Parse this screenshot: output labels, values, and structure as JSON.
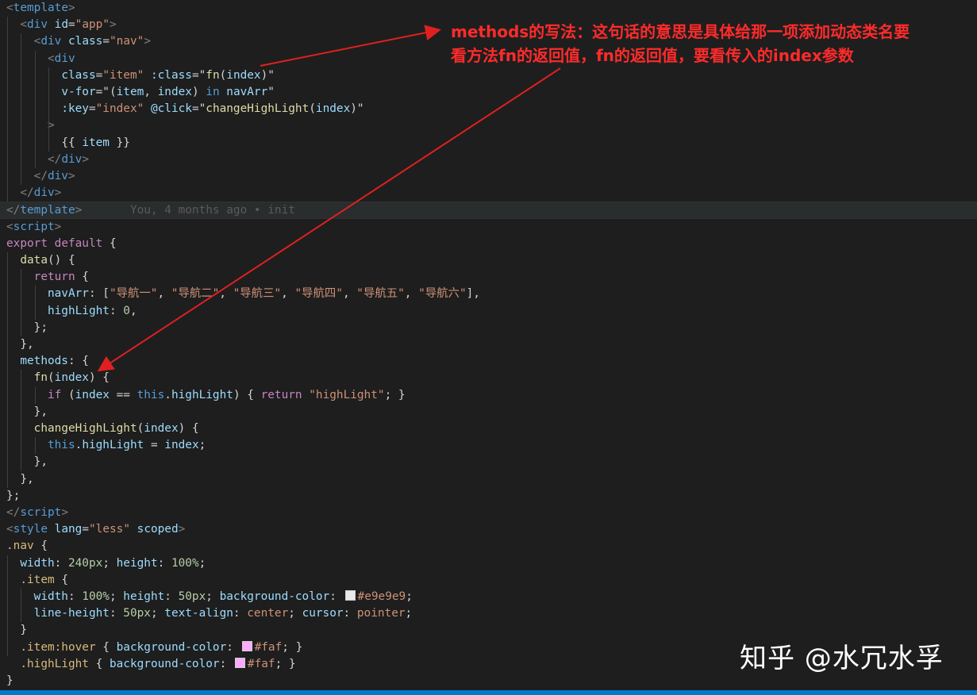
{
  "colors": {
    "background": "#1e1e1e",
    "tag": "#808080",
    "tag_name": "#569cd6",
    "attr": "#9cdcfe",
    "string": "#ce9178",
    "keyword": "#c586c0",
    "func": "#dcdcaa",
    "plain": "#d4d4d4",
    "number": "#b5cea8",
    "blame": "#5a5a5a",
    "selector": "#d7ba7d",
    "css_value": "#ce9178",
    "annotation": "#ff2b2b",
    "statusbar": "#007acc",
    "swatch_e9": "#e9e9e9",
    "swatch_faf": "#ffaaff"
  },
  "code_lines": [
    [
      [
        "<",
        "#808080"
      ],
      [
        "template",
        "#569cd6"
      ],
      [
        ">",
        "#808080"
      ]
    ],
    [
      [
        "  "
      ],
      [
        "<",
        "#808080"
      ],
      [
        "div",
        "#569cd6"
      ],
      [
        " "
      ],
      [
        "id",
        "#9cdcfe"
      ],
      [
        "=",
        "#d4d4d4"
      ],
      [
        "\"app\"",
        "#ce9178"
      ],
      [
        ">",
        "#808080"
      ]
    ],
    [
      [
        "    "
      ],
      [
        "<",
        "#808080"
      ],
      [
        "div",
        "#569cd6"
      ],
      [
        " "
      ],
      [
        "class",
        "#9cdcfe"
      ],
      [
        "=",
        "#d4d4d4"
      ],
      [
        "\"nav\"",
        "#ce9178"
      ],
      [
        ">",
        "#808080"
      ]
    ],
    [
      [
        "      "
      ],
      [
        "<",
        "#808080"
      ],
      [
        "div",
        "#569cd6"
      ]
    ],
    [
      [
        "        "
      ],
      [
        "class",
        "#9cdcfe"
      ],
      [
        "=",
        "#d4d4d4"
      ],
      [
        "\"item\"",
        "#ce9178"
      ],
      [
        " "
      ],
      [
        ":class",
        "#9cdcfe"
      ],
      [
        "=\"",
        "#d4d4d4"
      ],
      [
        "fn",
        "#dcdcaa"
      ],
      [
        "(",
        "#d4d4d4"
      ],
      [
        "index",
        "#9cdcfe"
      ],
      [
        ")\"",
        "#d4d4d4"
      ]
    ],
    [
      [
        "        "
      ],
      [
        "v-for",
        "#9cdcfe"
      ],
      [
        "=\"(",
        "#d4d4d4"
      ],
      [
        "item",
        "#9cdcfe"
      ],
      [
        ", ",
        "#d4d4d4"
      ],
      [
        "index",
        "#9cdcfe"
      ],
      [
        ") ",
        "#d4d4d4"
      ],
      [
        "in",
        "#569cd6"
      ],
      [
        " "
      ],
      [
        "navArr",
        "#9cdcfe"
      ],
      [
        "\"",
        "#d4d4d4"
      ]
    ],
    [
      [
        "        "
      ],
      [
        ":key",
        "#9cdcfe"
      ],
      [
        "=",
        "#d4d4d4"
      ],
      [
        "\"index\"",
        "#ce9178"
      ],
      [
        " "
      ],
      [
        "@click",
        "#9cdcfe"
      ],
      [
        "=\"",
        "#d4d4d4"
      ],
      [
        "changeHighLight",
        "#dcdcaa"
      ],
      [
        "(",
        "#d4d4d4"
      ],
      [
        "index",
        "#9cdcfe"
      ],
      [
        ")\"",
        "#d4d4d4"
      ]
    ],
    [
      [
        "      "
      ],
      [
        ">",
        "#808080"
      ]
    ],
    [
      [
        "        "
      ],
      [
        "{{ ",
        "#d4d4d4"
      ],
      [
        "item",
        "#9cdcfe"
      ],
      [
        " }}",
        "#d4d4d4"
      ]
    ],
    [
      [
        "      "
      ],
      [
        "</",
        "#808080"
      ],
      [
        "div",
        "#569cd6"
      ],
      [
        ">",
        "#808080"
      ]
    ],
    [
      [
        "    "
      ],
      [
        "</",
        "#808080"
      ],
      [
        "div",
        "#569cd6"
      ],
      [
        ">",
        "#808080"
      ]
    ],
    [
      [
        "  "
      ],
      [
        "</",
        "#808080"
      ],
      [
        "div",
        "#569cd6"
      ],
      [
        ">",
        "#808080"
      ]
    ],
    [
      [
        "</",
        "#808080"
      ],
      [
        "template",
        "#569cd6"
      ],
      [
        ">",
        "#808080"
      ],
      [
        "       You, 4 months ago • init",
        "#5a5a5a"
      ]
    ],
    [
      [
        "<",
        "#808080"
      ],
      [
        "script",
        "#569cd6"
      ],
      [
        ">",
        "#808080"
      ]
    ],
    [
      [
        "export",
        "#c586c0"
      ],
      [
        " "
      ],
      [
        "default",
        "#c586c0"
      ],
      [
        " {",
        "#d4d4d4"
      ]
    ],
    [
      [
        "  "
      ],
      [
        "data",
        "#dcdcaa"
      ],
      [
        "() {",
        "#d4d4d4"
      ]
    ],
    [
      [
        "    "
      ],
      [
        "return",
        "#c586c0"
      ],
      [
        " {",
        "#d4d4d4"
      ]
    ],
    [
      [
        "      "
      ],
      [
        "navArr",
        "#9cdcfe"
      ],
      [
        ": [",
        "#d4d4d4"
      ],
      [
        "\"导航一\"",
        "#ce9178"
      ],
      [
        ", ",
        "#d4d4d4"
      ],
      [
        "\"导航二\"",
        "#ce9178"
      ],
      [
        ", ",
        "#d4d4d4"
      ],
      [
        "\"导航三\"",
        "#ce9178"
      ],
      [
        ", ",
        "#d4d4d4"
      ],
      [
        "\"导航四\"",
        "#ce9178"
      ],
      [
        ", ",
        "#d4d4d4"
      ],
      [
        "\"导航五\"",
        "#ce9178"
      ],
      [
        ", ",
        "#d4d4d4"
      ],
      [
        "\"导航六\"",
        "#ce9178"
      ],
      [
        "],",
        "#d4d4d4"
      ]
    ],
    [
      [
        "      "
      ],
      [
        "highLight",
        "#9cdcfe"
      ],
      [
        ": ",
        "#d4d4d4"
      ],
      [
        "0",
        "#b5cea8"
      ],
      [
        ",",
        "#d4d4d4"
      ]
    ],
    [
      [
        "    "
      ],
      [
        "};",
        "#d4d4d4"
      ]
    ],
    [
      [
        "  "
      ],
      [
        "},",
        "#d4d4d4"
      ]
    ],
    [
      [
        "  "
      ],
      [
        "methods",
        "#9cdcfe"
      ],
      [
        ": {",
        "#d4d4d4"
      ]
    ],
    [
      [
        "    "
      ],
      [
        "fn",
        "#dcdcaa"
      ],
      [
        "(",
        "#d4d4d4"
      ],
      [
        "index",
        "#9cdcfe"
      ],
      [
        ") {",
        "#d4d4d4"
      ]
    ],
    [
      [
        "      "
      ],
      [
        "if",
        "#c586c0"
      ],
      [
        " (",
        "#d4d4d4"
      ],
      [
        "index",
        "#9cdcfe"
      ],
      [
        " == ",
        "#d4d4d4"
      ],
      [
        "this",
        "#569cd6"
      ],
      [
        ".",
        "#d4d4d4"
      ],
      [
        "highLight",
        "#9cdcfe"
      ],
      [
        ") { ",
        "#d4d4d4"
      ],
      [
        "return",
        "#c586c0"
      ],
      [
        " "
      ],
      [
        "\"highLight\"",
        "#ce9178"
      ],
      [
        "; }",
        "#d4d4d4"
      ]
    ],
    [
      [
        "    "
      ],
      [
        "},",
        "#d4d4d4"
      ]
    ],
    [
      [
        "    "
      ],
      [
        "changeHighLight",
        "#dcdcaa"
      ],
      [
        "(",
        "#d4d4d4"
      ],
      [
        "index",
        "#9cdcfe"
      ],
      [
        ") {",
        "#d4d4d4"
      ]
    ],
    [
      [
        "      "
      ],
      [
        "this",
        "#569cd6"
      ],
      [
        ".",
        "#d4d4d4"
      ],
      [
        "highLight",
        "#9cdcfe"
      ],
      [
        " = ",
        "#d4d4d4"
      ],
      [
        "index",
        "#9cdcfe"
      ],
      [
        ";",
        "#d4d4d4"
      ]
    ],
    [
      [
        "    "
      ],
      [
        "},",
        "#d4d4d4"
      ]
    ],
    [
      [
        "  "
      ],
      [
        "},",
        "#d4d4d4"
      ]
    ],
    [
      [
        "};",
        "#d4d4d4"
      ]
    ],
    [
      [
        "</",
        "#808080"
      ],
      [
        "script",
        "#569cd6"
      ],
      [
        ">",
        "#808080"
      ]
    ],
    [
      [
        "<",
        "#808080"
      ],
      [
        "style",
        "#569cd6"
      ],
      [
        " "
      ],
      [
        "lang",
        "#9cdcfe"
      ],
      [
        "=",
        "#d4d4d4"
      ],
      [
        "\"less\"",
        "#ce9178"
      ],
      [
        " "
      ],
      [
        "scoped",
        "#9cdcfe"
      ],
      [
        ">",
        "#808080"
      ]
    ],
    [
      [
        ".nav",
        "#d7ba7d"
      ],
      [
        " {",
        "#d4d4d4"
      ]
    ],
    [
      [
        "  "
      ],
      [
        "width",
        "#9cdcfe"
      ],
      [
        ": ",
        "#d4d4d4"
      ],
      [
        "240px",
        "#b5cea8"
      ],
      [
        "; ",
        "#d4d4d4"
      ],
      [
        "height",
        "#9cdcfe"
      ],
      [
        ": ",
        "#d4d4d4"
      ],
      [
        "100%",
        "#b5cea8"
      ],
      [
        ";",
        "#d4d4d4"
      ]
    ],
    [
      [
        "  "
      ],
      [
        ".item",
        "#d7ba7d"
      ],
      [
        " {",
        "#d4d4d4"
      ]
    ],
    [
      [
        "    "
      ],
      [
        "width",
        "#9cdcfe"
      ],
      [
        ": ",
        "#d4d4d4"
      ],
      [
        "100%",
        "#b5cea8"
      ],
      [
        "; ",
        "#d4d4d4"
      ],
      [
        "height",
        "#9cdcfe"
      ],
      [
        ": ",
        "#d4d4d4"
      ],
      [
        "50px",
        "#b5cea8"
      ],
      [
        "; ",
        "#d4d4d4"
      ],
      [
        "background-color",
        "#9cdcfe"
      ],
      [
        ": ",
        "#d4d4d4"
      ],
      [
        "",
        "swatch:#e9e9e9"
      ],
      [
        "#e9e9e9",
        "#ce9178"
      ],
      [
        ";",
        "#d4d4d4"
      ]
    ],
    [
      [
        "    "
      ],
      [
        "line-height",
        "#9cdcfe"
      ],
      [
        ": ",
        "#d4d4d4"
      ],
      [
        "50px",
        "#b5cea8"
      ],
      [
        "; ",
        "#d4d4d4"
      ],
      [
        "text-align",
        "#9cdcfe"
      ],
      [
        ": ",
        "#d4d4d4"
      ],
      [
        "center",
        "#ce9178"
      ],
      [
        "; ",
        "#d4d4d4"
      ],
      [
        "cursor",
        "#9cdcfe"
      ],
      [
        ": ",
        "#d4d4d4"
      ],
      [
        "pointer",
        "#ce9178"
      ],
      [
        ";",
        "#d4d4d4"
      ]
    ],
    [
      [
        "  "
      ],
      [
        "}",
        "#d4d4d4"
      ]
    ],
    [
      [
        "  "
      ],
      [
        ".item:hover",
        "#d7ba7d"
      ],
      [
        " { ",
        "#d4d4d4"
      ],
      [
        "background-color",
        "#9cdcfe"
      ],
      [
        ": ",
        "#d4d4d4"
      ],
      [
        "",
        "swatch:#ffaaff"
      ],
      [
        "#faf",
        "#ce9178"
      ],
      [
        "; }",
        "#d4d4d4"
      ]
    ],
    [
      [
        "  "
      ],
      [
        ".highLight",
        "#d7ba7d"
      ],
      [
        " { ",
        "#d4d4d4"
      ],
      [
        "background-color",
        "#9cdcfe"
      ],
      [
        ": ",
        "#d4d4d4"
      ],
      [
        "",
        "swatch:#ffaaff"
      ],
      [
        "#faf",
        "#ce9178"
      ],
      [
        "; }",
        "#d4d4d4"
      ]
    ],
    [
      [
        "}",
        "#d4d4d4"
      ]
    ]
  ],
  "blame_line_index": 12,
  "annotation": {
    "line1": "methods的写法：这句话的意思是具体给那一项添加动态类名要",
    "line2": "看方法fn的返回值，fn的返回值，要看传入的index参数"
  },
  "watermark": "知乎 @水冗水孚"
}
